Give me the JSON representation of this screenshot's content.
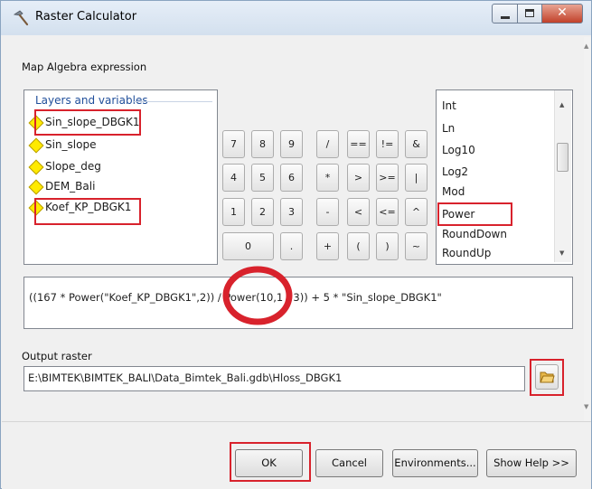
{
  "window": {
    "title": "Raster Calculator"
  },
  "expression_section": {
    "label": "Map Algebra expression"
  },
  "layers": {
    "header": "Layers and variables",
    "items": [
      {
        "label": "Sin_slope_DBGK1",
        "highlighted": true
      },
      {
        "label": "Sin_slope",
        "highlighted": false
      },
      {
        "label": "Slope_deg",
        "highlighted": false
      },
      {
        "label": "DEM_Bali",
        "highlighted": false
      },
      {
        "label": "Koef_KP_DBGK1",
        "highlighted": true
      }
    ]
  },
  "calculator": {
    "rows": [
      [
        "7",
        "8",
        "9",
        "/",
        "==",
        "!=",
        "&"
      ],
      [
        "4",
        "5",
        "6",
        "*",
        ">",
        ">=",
        "|"
      ],
      [
        "1",
        "2",
        "3",
        "-",
        "<",
        "<=",
        "^"
      ],
      [
        "0",
        ".",
        "+",
        "(",
        ")",
        "~"
      ]
    ]
  },
  "functions": {
    "items": [
      "Int",
      "Ln",
      "Log10",
      "Log2",
      "Mod",
      "Power",
      "RoundDown",
      "RoundUp"
    ],
    "highlighted": "Power"
  },
  "expression": {
    "value": "((167 * Power(\"Koef_KP_DBGK1\",2)) / Power(10,1 / 3)) + 5 * \"Sin_slope_DBGK1\""
  },
  "output": {
    "label": "Output raster",
    "value": "E:\\BIMTEK\\BIMTEK_BALI\\Data_Bimtek_Bali.gdb\\Hloss_DBGK1"
  },
  "buttons": {
    "ok": "OK",
    "cancel": "Cancel",
    "environments": "Environments...",
    "help": "Show Help >>"
  },
  "colors": {
    "highlight_red": "#d8222c",
    "layer_icon_yellow": "#ffea00",
    "header_blue": "#1f4e9a"
  }
}
